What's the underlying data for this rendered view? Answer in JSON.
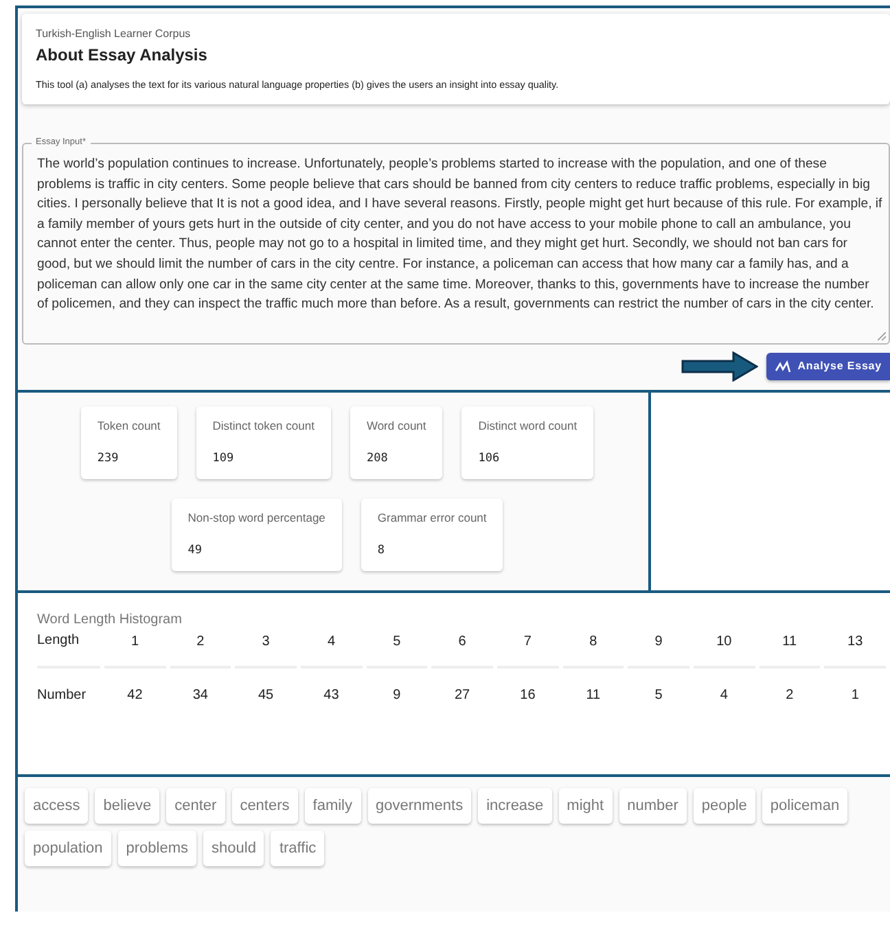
{
  "header": {
    "subtitle": "Turkish-English Learner Corpus",
    "title": "About Essay Analysis",
    "description": "This tool (a) analyses the text for its various natural language properties (b) gives the users an insight into essay quality."
  },
  "essay_input": {
    "label": "Essay Input*",
    "value": "The world’s population continues to increase. Unfortunately, people’s problems started to increase with the population, and one of these problems is traffic in city centers. Some people believe that cars should be banned from city centers to reduce traffic problems, especially in big cities. I personally believe that It is not a good idea, and I have several reasons. Firstly, people might get hurt because of this rule. For example, if a family member of yours gets hurt in the outside of city center, and you do not have access to your mobile phone to call an ambulance, you cannot enter the center. Thus, people may not go to a hospital in limited time, and they might get hurt. Secondly, we should not ban cars for good, but we should limit the number of cars in the city centre. For instance, a policeman can access that how many car a family has, and a policeman can allow only one car in the same city center at the same time. Moreover, thanks to this, governments have to increase the number of policemen, and they can inspect the traffic much more than before. As a result, governments can restrict the number of cars in the city center."
  },
  "analyse_button": {
    "label": "Analyse Essay"
  },
  "stats": [
    {
      "label": "Token count",
      "value": "239"
    },
    {
      "label": "Distinct token count",
      "value": "109"
    },
    {
      "label": "Word count",
      "value": "208"
    },
    {
      "label": "Distinct word count",
      "value": "106"
    },
    {
      "label": "Non-stop word percentage",
      "value": "49"
    },
    {
      "label": "Grammar error count",
      "value": "8"
    }
  ],
  "histogram": {
    "title": "Word Length Histogram",
    "rows": [
      {
        "label": "Length",
        "cells": [
          "1",
          "2",
          "3",
          "4",
          "5",
          "6",
          "7",
          "8",
          "9",
          "10",
          "11",
          "13"
        ]
      },
      {
        "label": "Number",
        "cells": [
          "42",
          "34",
          "45",
          "43",
          "9",
          "27",
          "16",
          "11",
          "5",
          "4",
          "2",
          "1"
        ]
      }
    ]
  },
  "keywords": [
    "access",
    "believe",
    "center",
    "centers",
    "family",
    "governments",
    "increase",
    "might",
    "number",
    "people",
    "policeman",
    "population",
    "problems",
    "should",
    "traffic"
  ]
}
